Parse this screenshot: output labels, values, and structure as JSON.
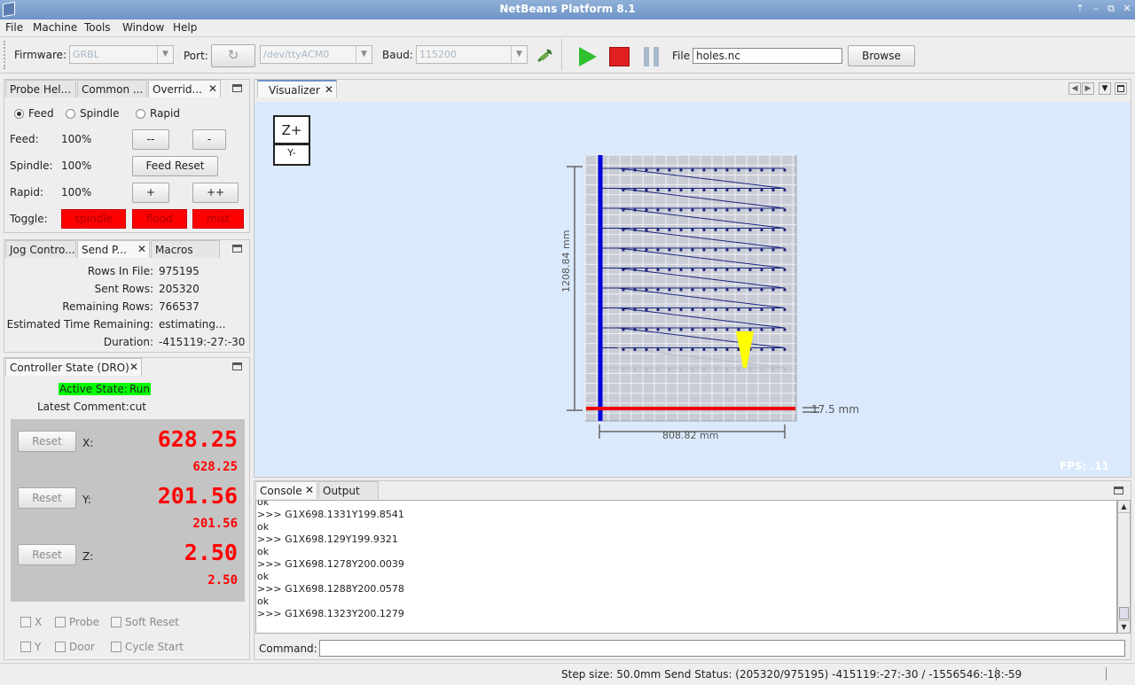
{
  "window": {
    "title": "NetBeans Platform 8.1"
  },
  "menu": [
    "File",
    "Machine",
    "Tools",
    "Window",
    "Help"
  ],
  "toolbar": {
    "firmware_label": "Firmware:",
    "firmware_value": "GRBL",
    "port_label": "Port:",
    "port_value": "/dev/ttyACM0",
    "baud_label": "Baud:",
    "baud_value": "115200",
    "file_label": "File",
    "file_value": "holes.nc",
    "browse_label": "Browse"
  },
  "override_panel": {
    "tabs": [
      "Probe Hel...",
      "Common ...",
      "Overrid..."
    ],
    "radios": [
      "Feed",
      "Spindle",
      "Rapid"
    ],
    "rows": [
      {
        "label": "Feed:",
        "value": "100%"
      },
      {
        "label": "Spindle:",
        "value": "100%"
      },
      {
        "label": "Rapid:",
        "value": "100%"
      }
    ],
    "btn_minus2": "--",
    "btn_minus": "-",
    "btn_feed_reset": "Feed Reset",
    "btn_plus": "+",
    "btn_plus2": "++",
    "toggle_label": "Toggle:",
    "toggles": [
      "spindle",
      "flood",
      "mist"
    ]
  },
  "send_panel": {
    "tabs": [
      "Jog Contro...",
      "Send P...",
      "Macros"
    ],
    "rows": [
      {
        "label": "Rows In File:",
        "value": "975195"
      },
      {
        "label": "Sent Rows:",
        "value": "205320"
      },
      {
        "label": "Remaining Rows:",
        "value": "766537"
      },
      {
        "label": "Estimated Time Remaining:",
        "value": "estimating..."
      },
      {
        "label": "Duration:",
        "value": "-415119:-27:-30"
      }
    ]
  },
  "dro": {
    "tab": "Controller State (DRO)",
    "active_state_label": "Active State:",
    "active_state_value": "Run",
    "comment_label": "Latest Comment:",
    "comment_value": "cut",
    "reset_label": "Reset",
    "axes": [
      {
        "name": "X:",
        "work": "628.25",
        "machine": "628.25"
      },
      {
        "name": "Y:",
        "work": "201.56",
        "machine": "201.56"
      },
      {
        "name": "Z:",
        "work": "2.50",
        "machine": "2.50"
      }
    ],
    "checkboxes": [
      "X",
      "Probe",
      "Soft Reset",
      "Y",
      "Door",
      "Cycle Start"
    ]
  },
  "visualizer": {
    "tab": "Visualizer",
    "cube_top": "Z+",
    "cube_front": "Y-",
    "dim_height": "1208.84 mm",
    "dim_width": "808.82 mm",
    "dim_z": "17.5 mm",
    "fps": "FPS: .11"
  },
  "console": {
    "tabs": [
      "Console",
      "Output"
    ],
    "lines": [
      "ok",
      ">>> G1X698.1331Y199.8541",
      "ok",
      ">>> G1X698.129Y199.9321",
      "ok",
      ">>> G1X698.1278Y200.0039",
      "ok",
      ">>> G1X698.1288Y200.0578",
      "ok",
      ">>> G1X698.1323Y200.1279"
    ],
    "command_label": "Command:"
  },
  "status": {
    "text": "Step size: 50.0mm Send Status: (205320/975195) -415119:-27:-30 / -1556546:-18:-59"
  },
  "colors": {
    "dro_bg": "#c4c4c4",
    "dro_digits": "#ff0000",
    "active_green": "#00ff00",
    "viz_bg": "#dae9fb",
    "toggle_red": "#ff0000"
  }
}
